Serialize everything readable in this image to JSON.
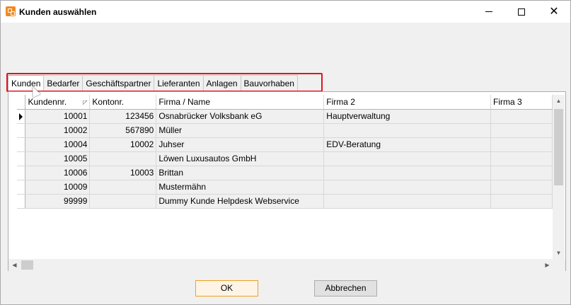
{
  "window": {
    "title": "Kunden auswählen",
    "controls": {
      "minimize": "—",
      "maximize": "☐",
      "close": "✕"
    }
  },
  "tabs": [
    {
      "label": "Kunden",
      "active": true
    },
    {
      "label": "Bedarfer",
      "active": false
    },
    {
      "label": "Geschäftspartner",
      "active": false
    },
    {
      "label": "Lieferanten",
      "active": false
    },
    {
      "label": "Anlagen",
      "active": false
    },
    {
      "label": "Bauvorhaben",
      "active": false
    }
  ],
  "grid": {
    "columns": [
      "Kundennr.",
      "Kontonr.",
      "Firma / Name",
      "Firma 2",
      "Firma 3"
    ],
    "rows": [
      {
        "kundennr": "10001",
        "kontonr": "123456",
        "firma": "Osnabrücker Volksbank eG",
        "firma2": "Hauptverwaltung",
        "firma3": ""
      },
      {
        "kundennr": "10002",
        "kontonr": "567890",
        "firma": "Müller",
        "firma2": "",
        "firma3": ""
      },
      {
        "kundennr": "10004",
        "kontonr": "10002",
        "firma": "Juhser",
        "firma2": "EDV-Beratung",
        "firma3": ""
      },
      {
        "kundennr": "10005",
        "kontonr": "",
        "firma": "Löwen Luxusautos GmbH",
        "firma2": "",
        "firma3": ""
      },
      {
        "kundennr": "10006",
        "kontonr": "10003",
        "firma": "Brittan",
        "firma2": "",
        "firma3": ""
      },
      {
        "kundennr": "10009",
        "kontonr": "",
        "firma": "Mustermähn",
        "firma2": "",
        "firma3": ""
      },
      {
        "kundennr": "99999",
        "kontonr": "",
        "firma": "Dummy Kunde Helpdesk Webservice",
        "firma2": "",
        "firma3": ""
      }
    ]
  },
  "buttons": {
    "ok": "OK",
    "cancel": "Abbrechen"
  },
  "colors": {
    "highlight": "#e0141e",
    "app_icon": "#f08a20",
    "ok_border": "#f0a020"
  }
}
